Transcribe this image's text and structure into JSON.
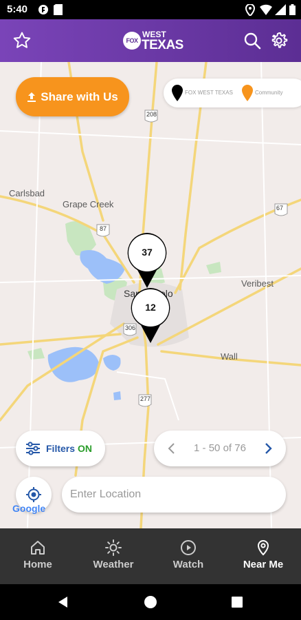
{
  "status_bar": {
    "time": "5:40",
    "icons": [
      "notification-icon",
      "sim-icon",
      "location-icon",
      "wifi-icon",
      "signal-icon",
      "battery-icon"
    ]
  },
  "header": {
    "logo": {
      "mark": "FOX",
      "line1": "WEST",
      "line2": "TEXAS"
    },
    "left_icon": "star-icon",
    "right_icons": [
      "search-icon",
      "gear-icon"
    ]
  },
  "map": {
    "share_button_label": "Share with Us",
    "legend": [
      {
        "label": "FOX WEST TEXAS",
        "color": "#000000"
      },
      {
        "label": "Community",
        "color": "#f7941d"
      }
    ],
    "place_labels": [
      "Carlsbad",
      "Grape Creek",
      "San Angelo",
      "Veribest",
      "Wall"
    ],
    "road_shields": [
      "208",
      "87",
      "67",
      "306",
      "277"
    ],
    "clusters": [
      {
        "count": "37"
      },
      {
        "count": "12"
      }
    ],
    "filters": {
      "label": "Filters",
      "state": "ON"
    },
    "pager": {
      "text": "1 - 50 of 76"
    },
    "location_input": {
      "placeholder": "Enter Location",
      "value": ""
    },
    "attribution": "Google"
  },
  "bottom_nav": [
    {
      "label": "Home",
      "icon": "home-icon",
      "active": false
    },
    {
      "label": "Weather",
      "icon": "sun-icon",
      "active": false
    },
    {
      "label": "Watch",
      "icon": "play-icon",
      "active": false
    },
    {
      "label": "Near Me",
      "icon": "location-pin-icon",
      "active": true
    }
  ],
  "colors": {
    "header_start": "#7a44b8",
    "header_end": "#5c2e94",
    "share_orange": "#f7941d",
    "filters_blue": "#2457a8",
    "filters_on_green": "#2a9d2a",
    "nav_bg": "#333333"
  }
}
